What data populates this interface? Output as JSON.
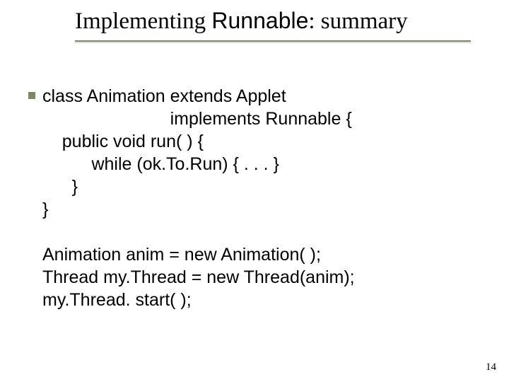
{
  "title": {
    "pre": "Implementing ",
    "mid": "Runnable",
    "post": ": summary"
  },
  "code": {
    "l1": "class Animation extends Applet",
    "l2": "                          implements Runnable {",
    "l3": "    public void run( ) {",
    "l4": "          while (ok.To.Run) { . . . }",
    "l5": "      }",
    "l6": "}",
    "blank": "",
    "l7": "Animation anim = new Animation( );",
    "l8": "Thread my.Thread = new Thread(anim);",
    "l9": "my.Thread. start( );"
  },
  "page_number": "14"
}
